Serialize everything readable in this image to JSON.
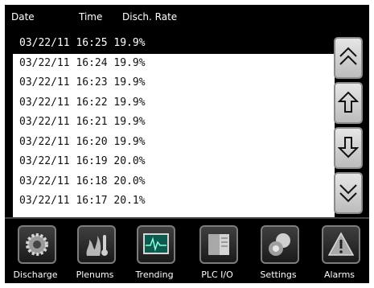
{
  "header": {
    "date_label": "Date",
    "time_label": "Time",
    "rate_label": "Disch. Rate"
  },
  "records": [
    {
      "text": "03/22/11 16:25 19.9%",
      "selected": true
    },
    {
      "text": "03/22/11 16:24 19.9%"
    },
    {
      "text": "03/22/11 16:23 19.9%"
    },
    {
      "text": "03/22/11 16:22 19.9%"
    },
    {
      "text": "03/22/11 16:21 19.9%"
    },
    {
      "text": "03/22/11 16:20 19.9%"
    },
    {
      "text": "03/22/11 16:19 20.0%"
    },
    {
      "text": "03/22/11 16:18 20.0%"
    },
    {
      "text": "03/22/11 16:17 20.1%"
    }
  ],
  "scroll_buttons": [
    "page-up-icon",
    "line-up-icon",
    "line-down-icon",
    "page-down-icon"
  ],
  "nav": [
    {
      "label": "Discharge",
      "icon": "gear-icon"
    },
    {
      "label": "Plenums",
      "icon": "flame-thermometer-icon"
    },
    {
      "label": "Trending",
      "icon": "monitor-trend-icon"
    },
    {
      "label": "PLC I/O",
      "icon": "plc-rack-icon"
    },
    {
      "label": "Settings",
      "icon": "settings-spheres-icon"
    },
    {
      "label": "Alarms",
      "icon": "warning-triangle-icon"
    }
  ],
  "colors": {
    "screen_bg": "#000000",
    "list_bg": "#ffffff",
    "selected_bg": "#000000"
  }
}
